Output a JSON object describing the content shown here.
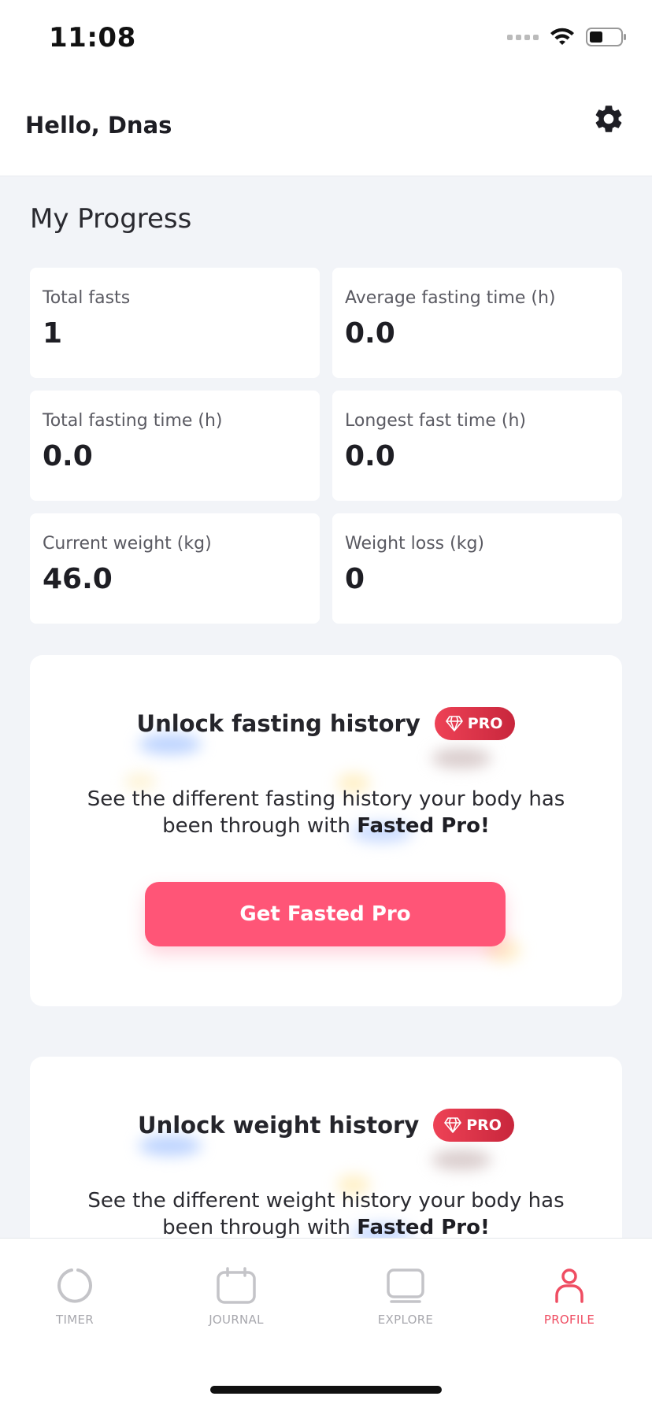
{
  "status_bar": {
    "time": "11:08"
  },
  "header": {
    "greeting": "Hello, Dnas"
  },
  "progress": {
    "title": "My Progress",
    "stats": [
      {
        "label": "Total fasts",
        "value": "1"
      },
      {
        "label": "Average fasting time (h)",
        "value": "0.0"
      },
      {
        "label": "Total fasting time (h)",
        "value": "0.0"
      },
      {
        "label": "Longest fast time (h)",
        "value": "0.0"
      },
      {
        "label": "Current weight (kg)",
        "value": "46.0"
      },
      {
        "label": "Weight loss (kg)",
        "value": "0"
      }
    ]
  },
  "promos": {
    "fasting": {
      "title": "Unlock fasting history",
      "badge": "PRO",
      "desc_prefix": "See the different fasting history your body has been through with ",
      "desc_bold": "Fasted Pro!",
      "button": "Get Fasted Pro"
    },
    "weight": {
      "title": "Unlock weight history",
      "badge": "PRO",
      "desc_prefix": "See the different weight history your body has been through with ",
      "desc_bold": "Fasted Pro!"
    }
  },
  "tabs": [
    {
      "label": "TIMER"
    },
    {
      "label": "JOURNAL"
    },
    {
      "label": "EXPLORE"
    },
    {
      "label": "PROFILE"
    }
  ],
  "colors": {
    "accent": "#ff5577",
    "active_tab": "#ef4d62",
    "pro_badge": "#e33a50",
    "background": "#f2f4f8"
  },
  "icons": {
    "settings": "gear-icon",
    "timer": "timer-icon",
    "journal": "calendar-icon",
    "explore": "explore-icon",
    "profile": "profile-icon",
    "pro": "diamond-icon"
  }
}
